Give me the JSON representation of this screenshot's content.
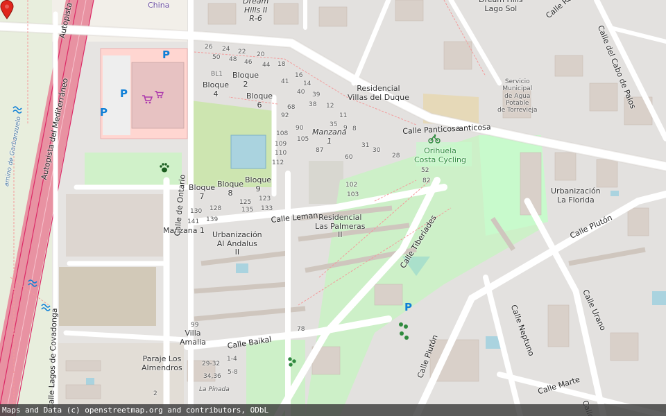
{
  "map": {
    "attribution": "Maps and Data (c) openstreetmap.org and contributors, ODbL",
    "colors": {
      "background": "#f2efe9",
      "residential": "#e0dfdf",
      "park": "#c8facc",
      "grass": "#cdebb0",
      "motorway": "#e892a2",
      "motorway_casing": "#dc2a67",
      "road": "#ffffff",
      "building": "#d9d0c9",
      "parking": "#eeeeee",
      "pitch": "#aae0cb",
      "retail": "#ffd6d1",
      "marker": "#e0261c",
      "text": "#333333"
    },
    "labels": {
      "china": "China",
      "dream_hills": "Dream\nHills II\nR-6",
      "dream_hills_lago": "Dream Hills\nLago Sol",
      "calle_re": "Calle Re",
      "calle_cabo_palos": "Calle del Cabo de Palos",
      "autopista_top": "Autopista",
      "autopista_med": "Autopista del Mediterráneo",
      "num_26": "26",
      "num_24": "24",
      "num_22": "22",
      "num_20": "20",
      "num_18": "18",
      "num_50": "50",
      "num_48": "48",
      "num_46": "46",
      "num_44": "44",
      "bl1": "BL1",
      "bloque2": "Bloque\n2",
      "num_16": "16",
      "num_14": "14",
      "num_41": "41",
      "num_40": "40",
      "num_39": "39",
      "bloque4": "Bloque\n4",
      "bloque6": "Bloque\n6",
      "residencial_villas": "Residencial\nVillas del Duque",
      "servicio_agua": "Servicio\nMunicipal\nde Agua\nPotable\nde Torrevieja",
      "num_68": "68",
      "num_38": "38",
      "num_12": "12",
      "num_11": "11",
      "num_92": "92",
      "num_90": "90",
      "manzana": "Manzana\n1",
      "num_35": "35",
      "num_9": "9",
      "num_108": "108",
      "num_109": "109",
      "num_110": "110",
      "num_112": "112",
      "num_105": "105",
      "num_87": "87",
      "num_8": "8",
      "num_31": "31",
      "num_30": "30",
      "num_28": "28",
      "num_60": "60",
      "calle_panticosa": "Calle Panticosa",
      "calle_panticosa2": "anticosa",
      "orihuela": "Orihuela\nCosta Cycling",
      "num_52": "52",
      "num_82": "82",
      "bloque7": "Bloque\n7",
      "bloque8": "Bloque\n8",
      "bloque9": "Bloque\n9",
      "num_130": "130",
      "num_128": "128",
      "num_125": "125",
      "num_123": "123",
      "num_141": "141",
      "num_139": "139",
      "num_135": "135",
      "num_133": "133",
      "num_102": "102",
      "num_103": "103",
      "calle_leman": "Calle Leman",
      "residencial_palmeras": "Residencial\nLas Palmeras\nII",
      "calle_tiberiades": "Calle Tiberiades",
      "urbanizacion_florida": "Urbanización\nLa Florida",
      "calle_pluton_top": "Calle Plutón",
      "manzana1": "Manzana 1",
      "urbanizacion_andalus": "Urbanización\nAl Andalus\nII",
      "calle_de_ontario": "Calle de Ontario",
      "calle_urano": "Calle Urano",
      "calle_neptuno": "Calle Neptuno",
      "num_99": "99",
      "villa_amalia": "Villa\nAmalia",
      "num_78": "78",
      "calle_baikal": "Calle Baikal",
      "paraje_almendros": "Paraje Los\nAlmendros",
      "num_29_32": "29-32",
      "num_1_4": "1-4",
      "num_34_36": "34,36",
      "num_5_8": "5-8",
      "la_pinada": "La Pinada",
      "num_2": "2",
      "calle_pluton_bottom": "Calle Plutón",
      "calle_marte": "Calle Marte",
      "calle_c": "Calle",
      "calle_lagos_covadonga": "Calle Lagos de Covadonga",
      "camino_garbanzuelo": "amino de Garbanzuelo"
    },
    "icons": {
      "parking": "parking-icon",
      "shop": "shopping-cart-icon",
      "veterinary": "paw-icon",
      "bicycle": "bicycle-icon",
      "marker": "location-marker-icon",
      "park": "tree-cluster-icon",
      "spring": "water-spring-icon"
    },
    "parking_symbol": "P"
  }
}
